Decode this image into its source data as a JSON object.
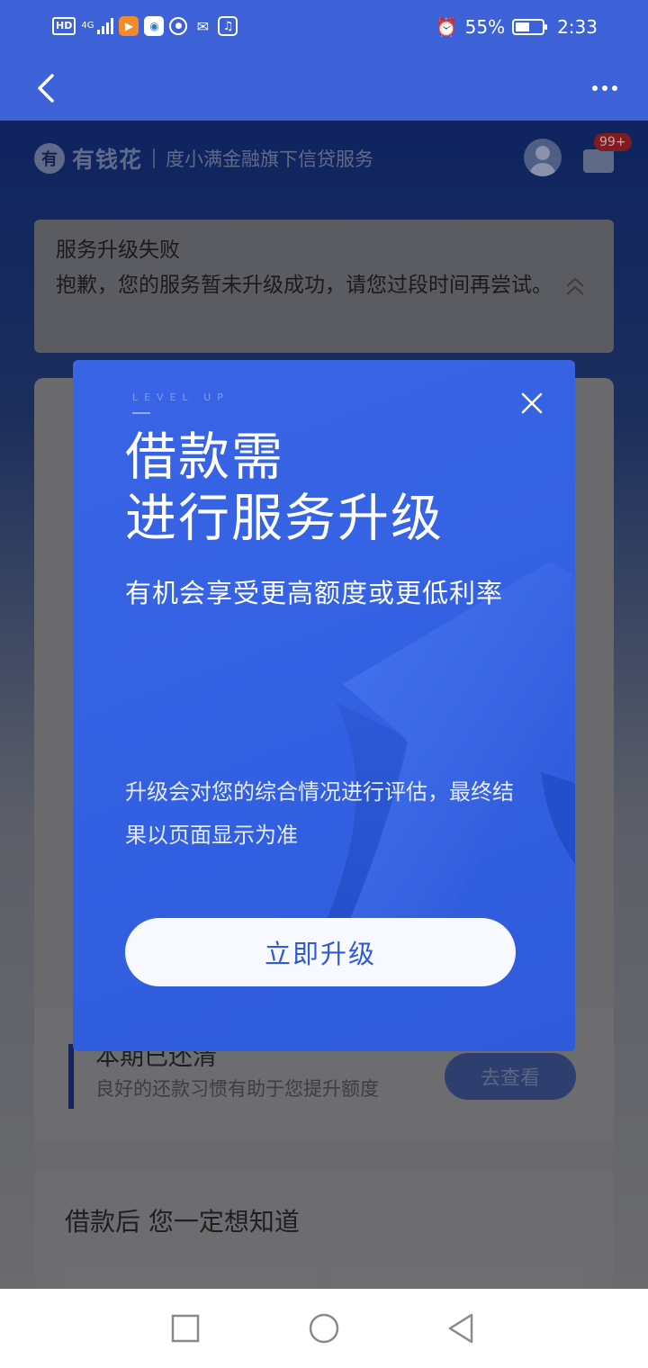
{
  "status_bar": {
    "hd": "HD",
    "network": "4G",
    "battery": "55%",
    "battery_level": 0.55,
    "time": "2:33",
    "app_icons": [
      "video-app-icon",
      "browser-app-icon",
      "camera-app-icon",
      "wechat-icon",
      "music-icon"
    ]
  },
  "header": {
    "brand_name": "有钱花",
    "brand_subtitle": "度小满金融旗下信贷服务",
    "message_badge": "99+"
  },
  "notice": {
    "title": "服务升级失败",
    "body": "抱歉，您的服务暂未升级成功，请您过段时间再尝试。"
  },
  "repayment": {
    "title": "本期已还清",
    "subtitle": "良好的还款习惯有助于您提升额度",
    "view_label": "去查看"
  },
  "section": {
    "title": "借款后  您一定想知道"
  },
  "modal": {
    "tag": "LEVEL UP",
    "headline_line1": "借款需",
    "headline_line2": "进行服务升级",
    "subline": "有机会享受更高额度或更低利率",
    "note": "升级会对您的综合情况进行评估，最终结果以页面显示为准",
    "cta_label": "立即升级"
  },
  "colors": {
    "primary": "#3d62d8",
    "modal_bg": "#3562e4",
    "cta_text": "#2f5ad8"
  }
}
